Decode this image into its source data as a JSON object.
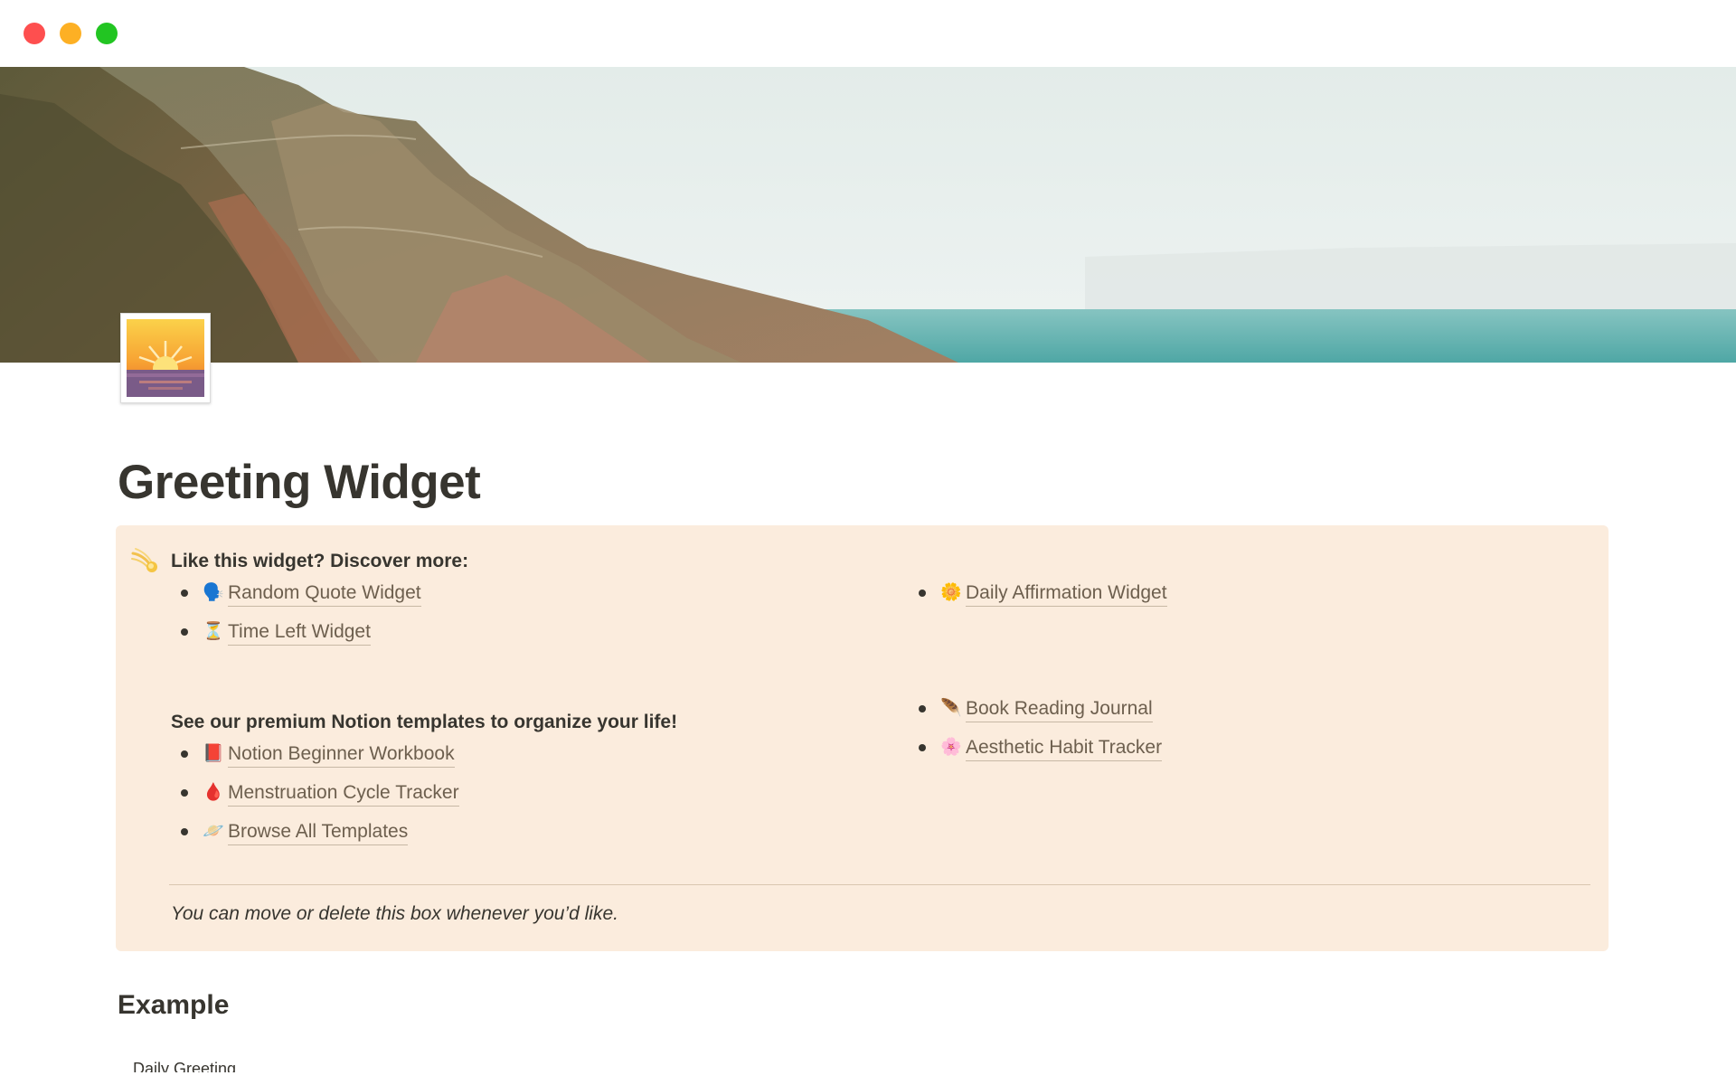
{
  "window": {
    "controls": [
      "close",
      "minimize",
      "maximize"
    ]
  },
  "page": {
    "icon": "sunrise-icon",
    "title": "Greeting Widget"
  },
  "callout": {
    "icon": "comet-icon",
    "background": "#fbecdd",
    "heading": "Like this widget? Discover more:",
    "widgets_left": [
      {
        "icon": "speaking-head",
        "emoji": "🗣️",
        "label": "Random Quote Widget"
      },
      {
        "icon": "hourglass",
        "emoji": "⏳",
        "label": "Time Left Widget"
      }
    ],
    "widgets_right": [
      {
        "icon": "sunflower",
        "emoji": "🌼",
        "label": "Daily Affirmation Widget"
      }
    ],
    "premium_heading": "See our premium Notion templates to organize your life!",
    "templates_left": [
      {
        "icon": "red-book",
        "emoji": "📕",
        "label": "Notion Beginner Workbook"
      },
      {
        "icon": "drop-of-blood",
        "emoji": "🩸",
        "label": "Menstruation Cycle Tracker"
      },
      {
        "icon": "ringed-planet",
        "emoji": "🪐",
        "label": "Browse All Templates"
      }
    ],
    "templates_right": [
      {
        "icon": "feather",
        "emoji": "🪶",
        "label": "Book Reading Journal"
      },
      {
        "icon": "cherry-blossom",
        "emoji": "🌸",
        "label": "Aesthetic Habit Tracker"
      }
    ],
    "note": "You can move or delete this box whenever you’d like."
  },
  "example": {
    "heading": "Example",
    "partial_text": "Daily Greeting"
  }
}
